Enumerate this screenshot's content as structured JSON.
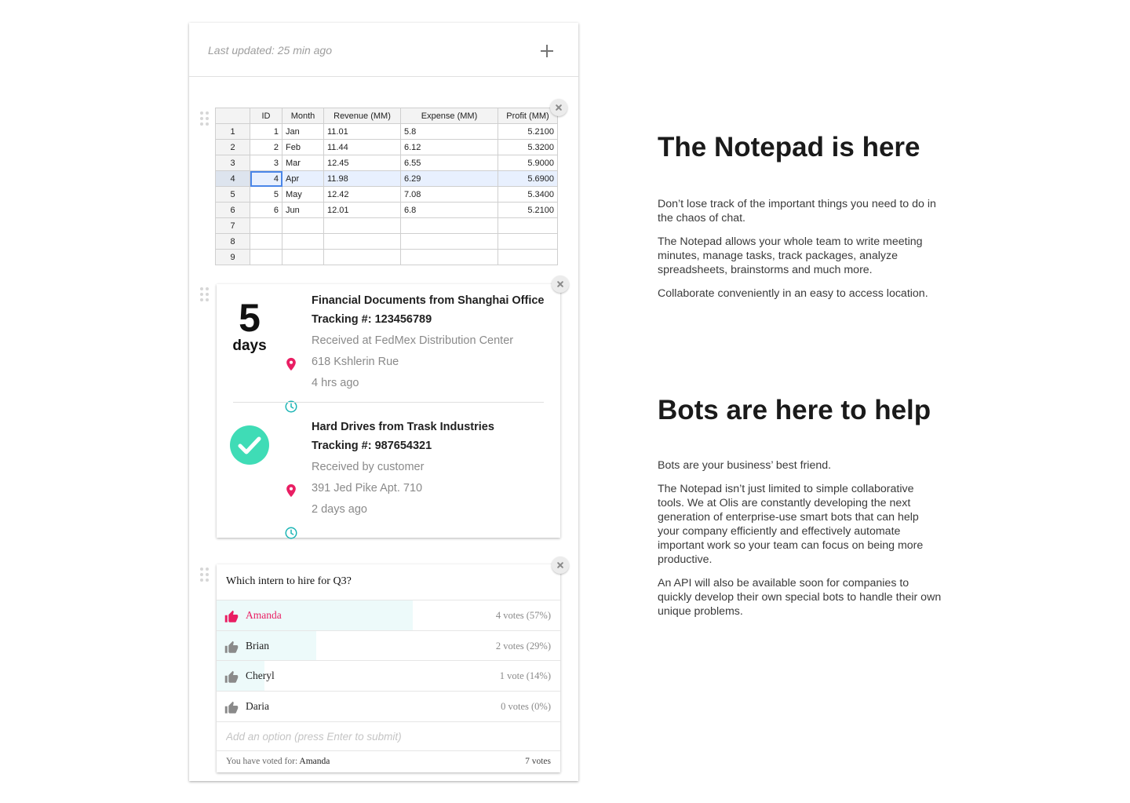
{
  "notepad": {
    "last_updated": "Last updated: 25 min ago",
    "add_label": "+"
  },
  "spreadsheet": {
    "columns": [
      "ID",
      "Month",
      "Revenue (MM)",
      "Expense (MM)",
      "Profit (MM)"
    ],
    "row_headers": [
      "1",
      "2",
      "3",
      "4",
      "5",
      "6",
      "7",
      "8",
      "9"
    ],
    "rows": [
      [
        "1",
        "Jan",
        "11.01",
        "5.8",
        "5.2100"
      ],
      [
        "2",
        "Feb",
        "11.44",
        "6.12",
        "5.3200"
      ],
      [
        "3",
        "Mar",
        "12.45",
        "6.55",
        "5.9000"
      ],
      [
        "4",
        "Apr",
        "11.98",
        "6.29",
        "5.6900"
      ],
      [
        "5",
        "May",
        "12.42",
        "7.08",
        "5.3400"
      ],
      [
        "6",
        "Jun",
        "12.01",
        "6.8",
        "5.2100"
      ],
      [
        "",
        "",
        "",
        "",
        ""
      ],
      [
        "",
        "",
        "",
        "",
        ""
      ],
      [
        "",
        "",
        "",
        "",
        ""
      ]
    ],
    "selected_row": "4"
  },
  "packages": {
    "days_number": "5",
    "days_label": "days",
    "items": [
      {
        "title": "Financial Documents from Shanghai Office",
        "tracking": "Tracking #: 123456789",
        "status": "Received at FedMex Distribution Center",
        "address": "618 Kshlerin Rue",
        "time": "4 hrs ago"
      },
      {
        "title": "Hard Drives from Trask Industries",
        "tracking": "Tracking #: 987654321",
        "status": "Received by customer",
        "address": "391 Jed Pike Apt. 710",
        "time": "2 days ago"
      }
    ]
  },
  "poll": {
    "question": "Which intern to hire for Q3?",
    "options": [
      {
        "name": "Amanda",
        "votes": "4 votes (57%)",
        "share": 0.57
      },
      {
        "name": "Brian",
        "votes": "2 votes (29%)",
        "share": 0.29
      },
      {
        "name": "Cheryl",
        "votes": "1 vote (14%)",
        "share": 0.14
      },
      {
        "name": "Daria",
        "votes": "0 votes (0%)",
        "share": 0
      }
    ],
    "add_placeholder": "Add an option (press Enter to submit)",
    "voted_prefix": "You have voted for: ",
    "voted_for": "Amanda",
    "total_votes": "7 votes"
  },
  "marketing": {
    "notepad": {
      "heading": "The Notepad is here",
      "paragraphs": [
        "Don’t lose track of the important things you need to do in the chaos of chat.",
        "The Notepad allows your whole team to write meeting minutes, manage tasks, track packages, analyze spreadsheets, brainstorms and much more.",
        "Collaborate conveniently in an easy to access location."
      ]
    },
    "bots": {
      "heading": "Bots are here to help",
      "paragraphs": [
        "Bots are your business’ best friend.",
        "The Notepad isn’t just limited to simple collaborative tools. We at Olis are constantly developing the next generation of enterprise-use smart bots that can help your company efficiently and effectively automate important work so your team can focus on being more productive.",
        "An API will also be available soon for companies to quickly develop their own special bots to handle their own unique problems."
      ]
    }
  },
  "colors": {
    "accent_pink": "#e91e63",
    "accent_teal": "#1cb5b5",
    "check_green": "#3fdcb6",
    "poll_fill": "#edfafa",
    "selection_blue": "#4a86e8"
  },
  "icons": [
    "plus-icon",
    "drag-handle-icon",
    "close-icon",
    "location-pin-icon",
    "clock-icon",
    "checkmark-icon",
    "thumbs-up-icon"
  ]
}
